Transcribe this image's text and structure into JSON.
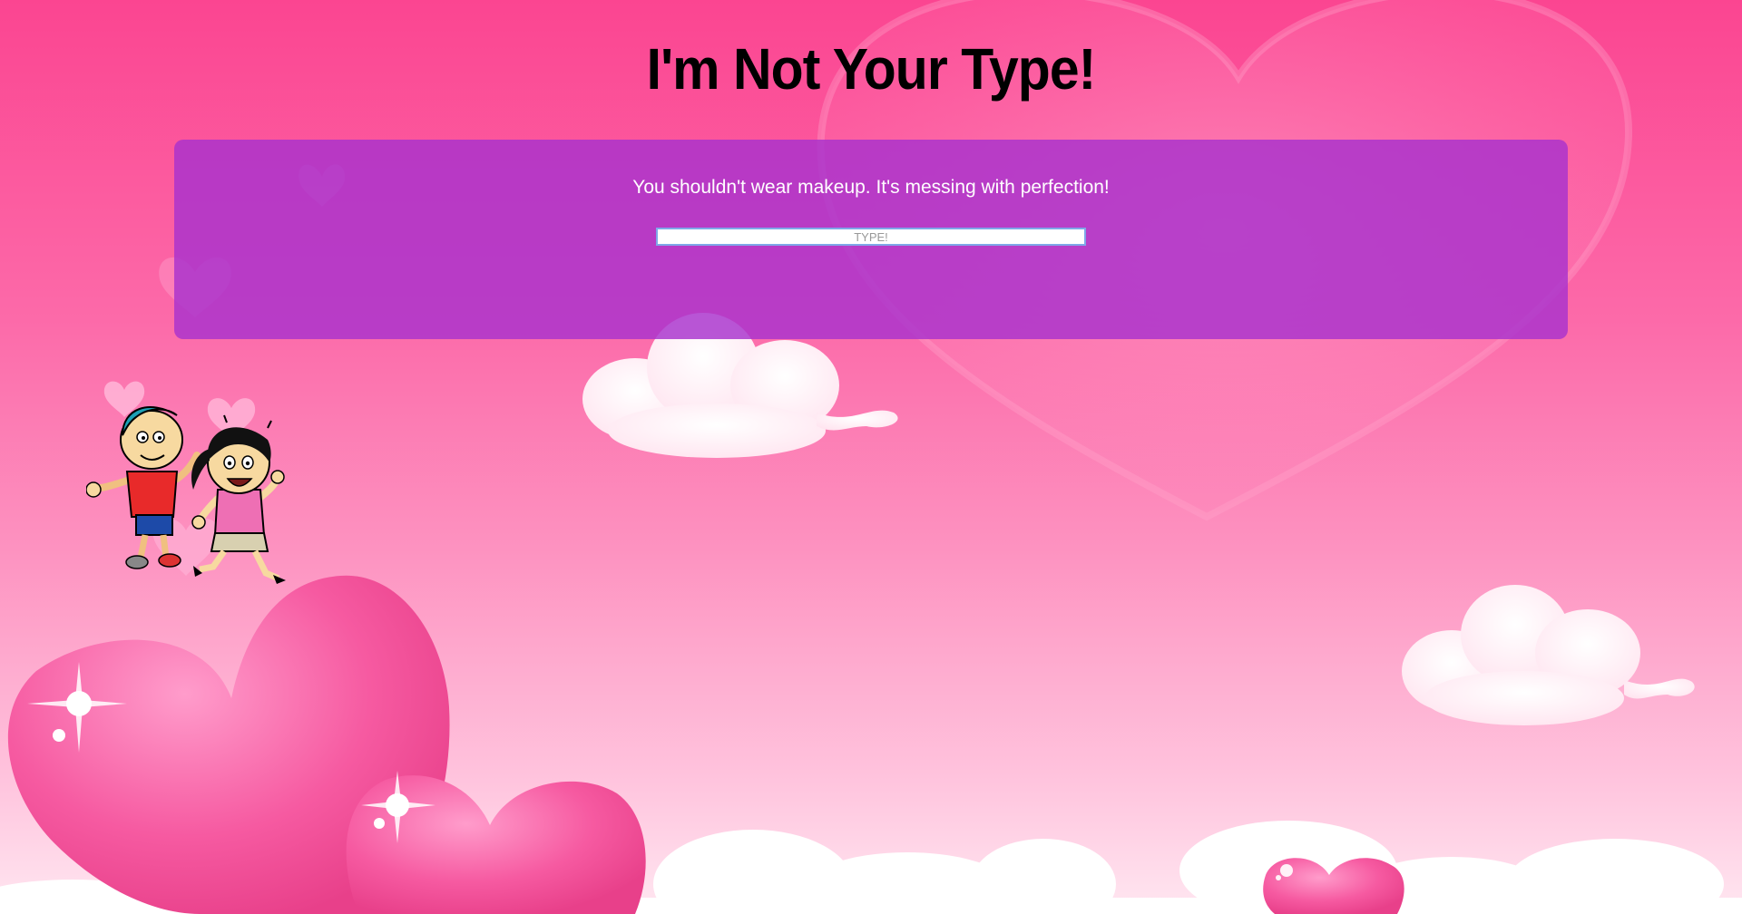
{
  "page": {
    "title": "I'm Not Your Type!"
  },
  "panel": {
    "message": "You shouldn't wear makeup. It's messing with perfection!",
    "input_placeholder": "TYPE!",
    "input_value": ""
  },
  "colors": {
    "background_top": "#fb4591",
    "background_bottom": "#ffe7f1",
    "panel": "#a832cd",
    "input_border": "#7fa8e8",
    "title_text": "#000000",
    "message_text": "#ffffff"
  },
  "icons": {
    "background": "hearts-and-clouds-illustration",
    "kids": "cartoon-kids-illustration"
  }
}
